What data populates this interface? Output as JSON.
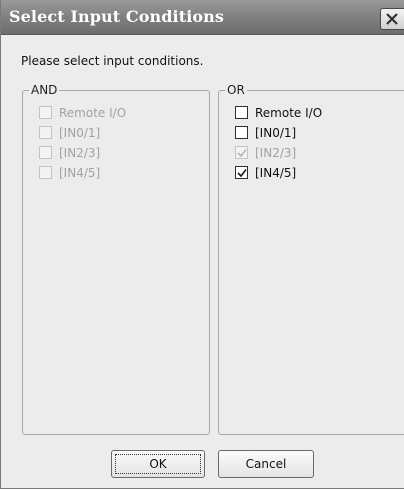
{
  "window": {
    "title": "Select Input Conditions"
  },
  "prompt": "Please select input conditions.",
  "groups": {
    "and": {
      "label": "AND",
      "options": [
        {
          "label": "Remote I/O",
          "checked": false,
          "enabled": false
        },
        {
          "label": "[IN0/1]",
          "checked": false,
          "enabled": false
        },
        {
          "label": "[IN2/3]",
          "checked": false,
          "enabled": false
        },
        {
          "label": "[IN4/5]",
          "checked": false,
          "enabled": false
        }
      ]
    },
    "or": {
      "label": "OR",
      "options": [
        {
          "label": "Remote I/O",
          "checked": false,
          "enabled": true
        },
        {
          "label": "[IN0/1]",
          "checked": false,
          "enabled": true
        },
        {
          "label": "[IN2/3]",
          "checked": true,
          "enabled": false
        },
        {
          "label": "[IN4/5]",
          "checked": true,
          "enabled": true
        }
      ]
    }
  },
  "buttons": {
    "ok": "OK",
    "cancel": "Cancel"
  },
  "colors": {
    "titlebar": "#828282",
    "dialog_bg": "#ececec",
    "disabled_text": "#a2a2a2"
  },
  "icons": {
    "close": "close-icon",
    "check": "checkmark-icon"
  }
}
